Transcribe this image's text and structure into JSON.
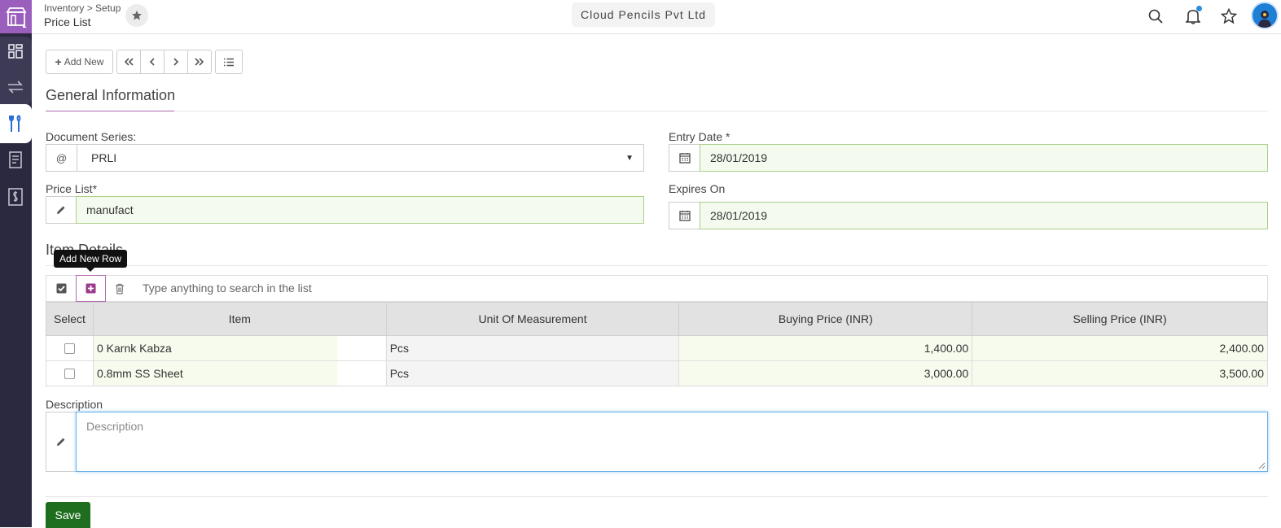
{
  "header": {
    "breadcrumb": "Inventory > Setup",
    "title": "Price List",
    "company": "Cloud Pencils Pvt Ltd"
  },
  "toolbar": {
    "add_new": "Add New"
  },
  "general": {
    "title": "General Information",
    "document_series_label": "Document Series:",
    "document_series_value": "PRLI",
    "entry_date_label": "Entry Date *",
    "entry_date_value": "28/01/2019",
    "price_list_label": "Price List*",
    "price_list_value": "manufact",
    "expires_on_label": "Expires On",
    "expires_on_value": "28/01/2019"
  },
  "items": {
    "title": "Item Details",
    "tooltip": "Add New Row",
    "search_placeholder": "Type anything to search in the list",
    "columns": [
      "Select",
      "Item",
      "Unit Of Measurement",
      "Buying Price (INR)",
      "Selling Price (INR)"
    ],
    "rows": [
      {
        "item": "0 Karnk Kabza",
        "uom": "Pcs",
        "buying": "1,400.00",
        "selling": "2,400.00"
      },
      {
        "item": "0.8mm SS Sheet",
        "uom": "Pcs",
        "buying": "3,000.00",
        "selling": "3,500.00"
      }
    ]
  },
  "description": {
    "label": "Description",
    "placeholder": "Description"
  },
  "save_label": "Save",
  "colors": {
    "sidebar": "#2b2940",
    "logo": "#9a5fbd",
    "accent": "#b06ab3",
    "save": "#1f6e1f",
    "field_fill": "#f4fbee"
  },
  "icons": [
    "store-logo-icon",
    "dashboard-icon",
    "transfer-icon",
    "tools-icon",
    "document-icon",
    "price-tag-icon",
    "star-icon",
    "search-icon",
    "bell-icon",
    "user-avatar-icon"
  ]
}
